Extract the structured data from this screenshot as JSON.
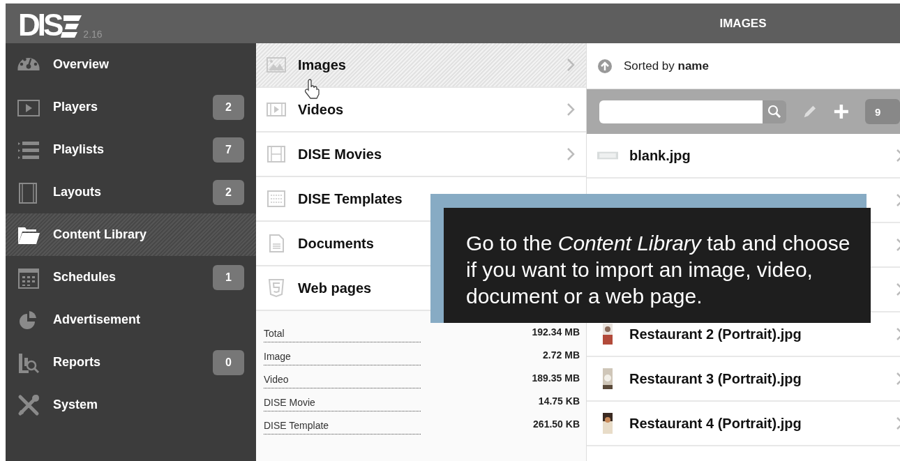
{
  "app": {
    "logo": "DIS",
    "version": "2.16"
  },
  "header": {
    "title": "IMAGES"
  },
  "sidebar": {
    "items": [
      {
        "label": "Overview",
        "selected": false
      },
      {
        "label": "Players",
        "badge": "2",
        "selected": false
      },
      {
        "label": "Playlists",
        "badge": "7",
        "selected": false
      },
      {
        "label": "Layouts",
        "badge": "2",
        "selected": false
      },
      {
        "label": "Content Library",
        "selected": true
      },
      {
        "label": "Schedules",
        "badge": "1",
        "selected": false
      },
      {
        "label": "Advertisement",
        "selected": false
      },
      {
        "label": "Reports",
        "badge": "0",
        "selected": false
      },
      {
        "label": "System",
        "selected": false
      }
    ]
  },
  "categories": [
    {
      "label": "Images",
      "selected": true
    },
    {
      "label": "Videos",
      "selected": false
    },
    {
      "label": "DISE Movies",
      "selected": false
    },
    {
      "label": "DISE Templates",
      "selected": false
    },
    {
      "label": "Documents",
      "selected": false
    },
    {
      "label": "Web pages",
      "selected": false
    }
  ],
  "storage": [
    {
      "label": "Total",
      "value": "192.34 MB"
    },
    {
      "label": "Image",
      "value": "2.72 MB"
    },
    {
      "label": "Video",
      "value": "189.35 MB"
    },
    {
      "label": "DISE Movie",
      "value": "14.75 KB"
    },
    {
      "label": "DISE Template",
      "value": "261.50 KB"
    }
  ],
  "library": {
    "sort": "Sorted by **name**",
    "count": "9"
  },
  "files": [
    {
      "kind": "file",
      "name": "blank.jpg"
    },
    {
      "kind": "covered"
    },
    {
      "kind": "covered"
    },
    {
      "kind": "covered"
    },
    {
      "kind": "file",
      "name": "Restaurant 2 (Portrait).jpg"
    },
    {
      "kind": "file",
      "name": "Restaurant 3 (Portrait).jpg"
    },
    {
      "kind": "file",
      "name": "Restaurant 4 (Portrait).jpg"
    }
  ],
  "tooltip": {
    "text": "Go to the *Content Library* tab and choose if you want to import an image, video, document or a web page."
  }
}
